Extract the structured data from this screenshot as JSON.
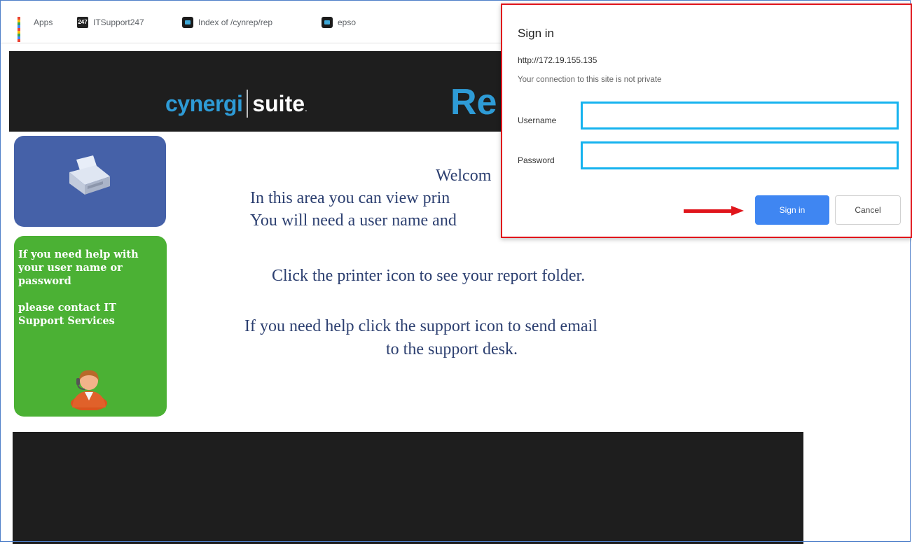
{
  "bookmarks": {
    "apps": "Apps",
    "item1": "ITSupport247",
    "item1_badge": "247",
    "item2": "Index of /cynrep/rep",
    "item3": "epso"
  },
  "banner": {
    "logo_left": "cynergi",
    "logo_right": "suite",
    "logo_suffix": ".",
    "title_partial": "Re"
  },
  "support": {
    "text1": "If you need help with your  user name or password",
    "text2": "please  contact IT Support Services"
  },
  "welcome": {
    "line1": "Welcom",
    "line2": "In this area you can view prin",
    "line3": "You will need a user name and",
    "line4": "Click the printer icon to see your report folder.",
    "line5": "If you need help click the support icon to send email",
    "line6": "to the support desk."
  },
  "dialog": {
    "title": "Sign in",
    "host": "http://172.19.155.135",
    "warning": "Your connection to this site is not private",
    "username_label": "Username",
    "username_value": "",
    "password_label": "Password",
    "password_value": "",
    "signin_label": "Sign in",
    "cancel_label": "Cancel"
  },
  "colors": {
    "banner_bg": "#1e1e1e",
    "brand_blue": "#2e9bd6",
    "printer_tile": "#4561a8",
    "support_tile": "#4bb134",
    "dialog_border": "#e0151b",
    "input_highlight": "#16b3ef",
    "signin_button": "#3f86f2",
    "arrow": "#e0151b"
  },
  "icons": [
    "apps-grid-icon",
    "itsupport-favicon",
    "index-favicon",
    "epso-favicon",
    "printer-icon",
    "support-person-icon",
    "red-arrow-icon"
  ]
}
